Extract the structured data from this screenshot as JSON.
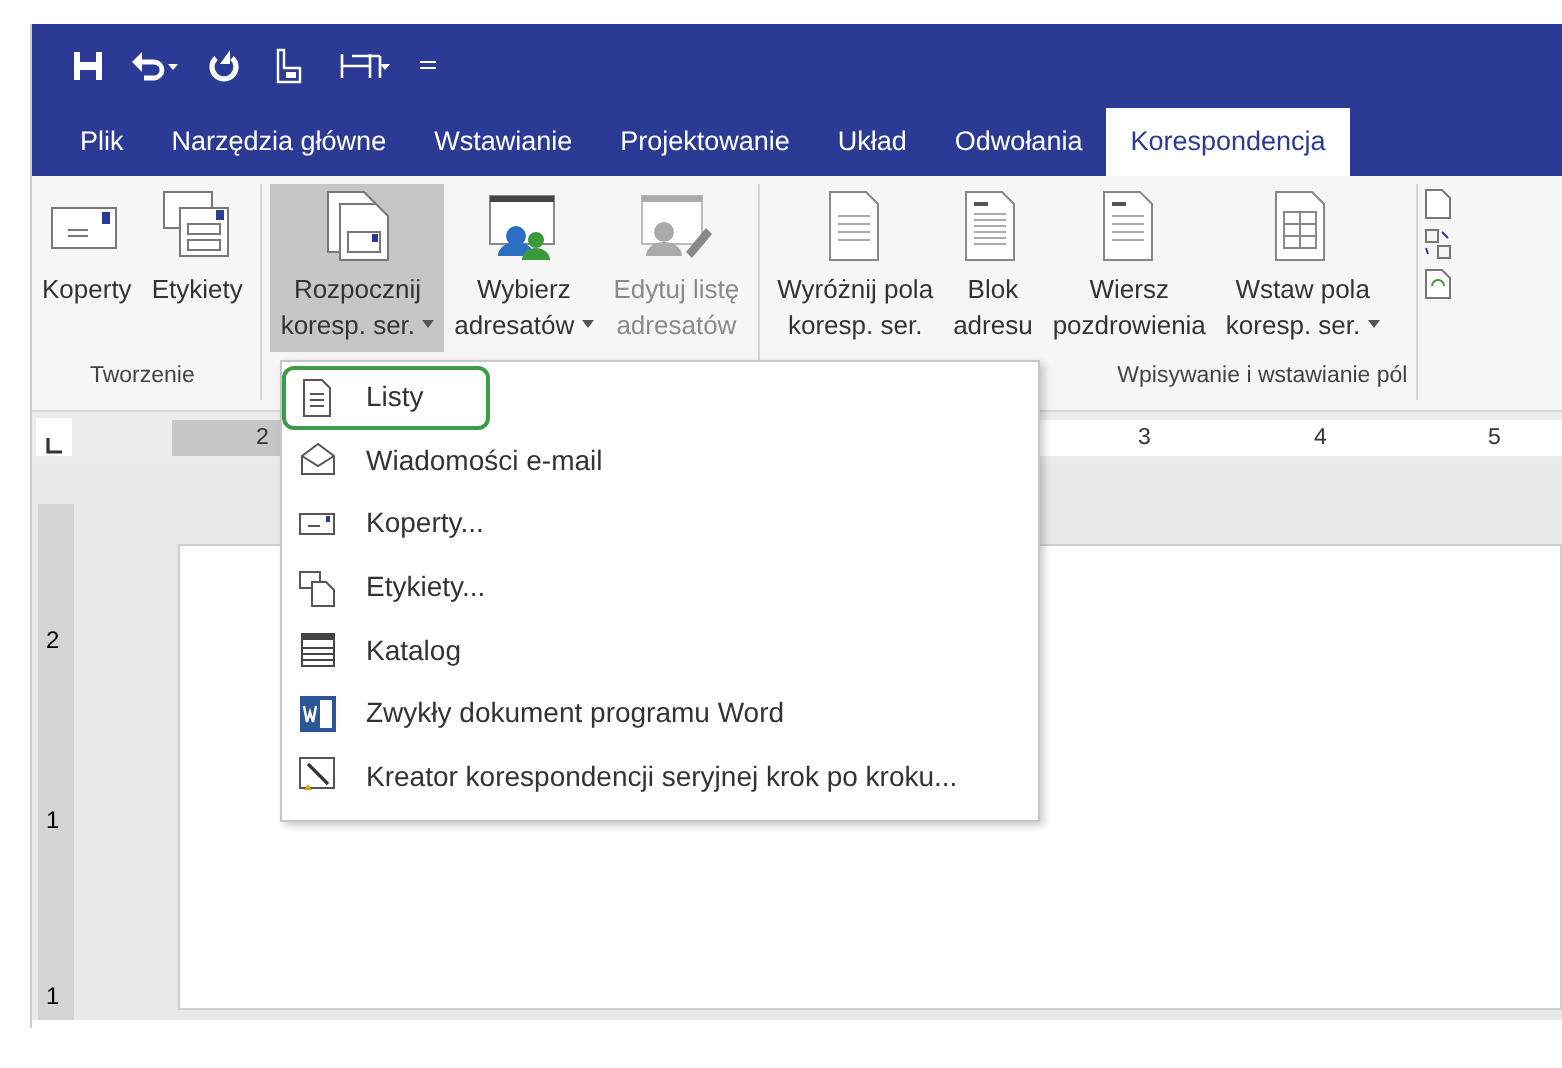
{
  "tabs": [
    {
      "label": "Plik",
      "selected": false
    },
    {
      "label": "Narzędzia główne",
      "selected": false
    },
    {
      "label": "Wstawianie",
      "selected": false
    },
    {
      "label": "Projektowanie",
      "selected": false
    },
    {
      "label": "Układ",
      "selected": false
    },
    {
      "label": "Odwołania",
      "selected": false
    },
    {
      "label": "Korespondencja",
      "selected": true
    }
  ],
  "ribbon": {
    "groups": [
      {
        "label": "Tworzenie",
        "buttons": [
          {
            "lines": [
              "Koperty"
            ],
            "dropdown": false,
            "pressed": false,
            "disabled": false
          },
          {
            "lines": [
              "Etykiety"
            ],
            "dropdown": false,
            "pressed": false,
            "disabled": false
          }
        ]
      },
      {
        "buttons": [
          {
            "lines": [
              "Rozpocznij",
              "koresp. ser."
            ],
            "dropdown": true,
            "pressed": true,
            "disabled": false
          },
          {
            "lines": [
              "Wybierz",
              "adresatów"
            ],
            "dropdown": true,
            "pressed": false,
            "disabled": false
          },
          {
            "lines": [
              "Edytuj listę",
              "adresatów"
            ],
            "dropdown": false,
            "pressed": false,
            "disabled": true
          }
        ]
      },
      {
        "label": "Wpisywanie i wstawianie pól",
        "buttons": [
          {
            "lines": [
              "Wyróżnij pola",
              "koresp. ser."
            ],
            "dropdown": false,
            "pressed": false,
            "disabled": false
          },
          {
            "lines": [
              "Blok",
              "adresu"
            ],
            "dropdown": false,
            "pressed": false,
            "disabled": false
          },
          {
            "lines": [
              "Wiersz",
              "pozdrowienia"
            ],
            "dropdown": false,
            "pressed": false,
            "disabled": false
          },
          {
            "lines": [
              "Wstaw pola",
              "koresp. ser."
            ],
            "dropdown": true,
            "pressed": false,
            "disabled": false
          }
        ]
      }
    ]
  },
  "ruler": {
    "marks": [
      "2",
      "3",
      "4",
      "5"
    ]
  },
  "vertical_ruler": {
    "marks": [
      "2",
      "1",
      "1"
    ]
  },
  "menu": {
    "items": [
      {
        "label": "Listy",
        "selected": true
      },
      {
        "label": "Wiadomości e-mail",
        "selected": false
      },
      {
        "label": "Koperty...",
        "selected": false
      },
      {
        "label": "Etykiety...",
        "selected": false
      },
      {
        "label": "Katalog",
        "selected": false
      },
      {
        "label": "Zwykły dokument programu Word",
        "selected": false
      },
      {
        "label": "Kreator korespondencji seryjnej krok po kroku...",
        "selected": false
      }
    ]
  }
}
